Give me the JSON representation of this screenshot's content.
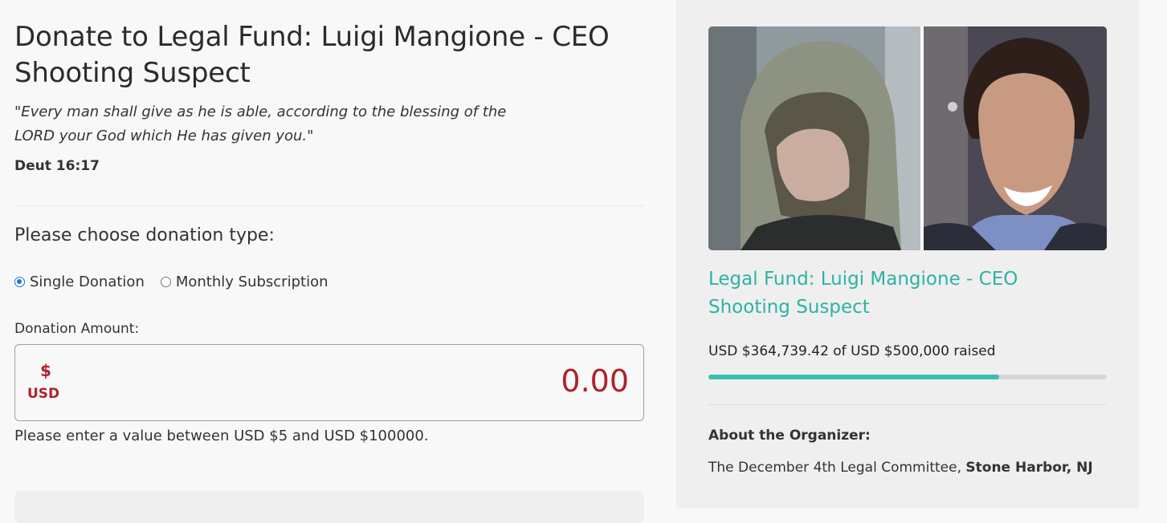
{
  "header": {
    "title": "Donate to Legal Fund: Luigi Mangione - CEO Shooting Suspect",
    "quote": "\"Every man shall give as he is able, according to the blessing of the LORD your God which He has given you.\"",
    "quote_reference": "Deut 16:17"
  },
  "donation_type": {
    "heading": "Please choose donation type:",
    "options": [
      {
        "label": "Single Donation",
        "selected": true
      },
      {
        "label": "Monthly Subscription",
        "selected": false
      }
    ]
  },
  "amount": {
    "label": "Donation Amount:",
    "currency_symbol": "$",
    "currency_code": "USD",
    "value": "0.00",
    "hint": "Please enter a value between USD $5 and USD $100000."
  },
  "fund": {
    "title": "Legal Fund: Luigi Mangione - CEO Shooting Suspect",
    "raised_text": "USD $364,739.42 of USD $500,000 raised",
    "progress_fraction": 0.7295,
    "accent_color": "#2bb3a3"
  },
  "organizer": {
    "label": "About the Organizer:",
    "name": "The December 4th Legal Committee",
    "separator": ", ",
    "location": "Stone Harbor, NJ"
  }
}
